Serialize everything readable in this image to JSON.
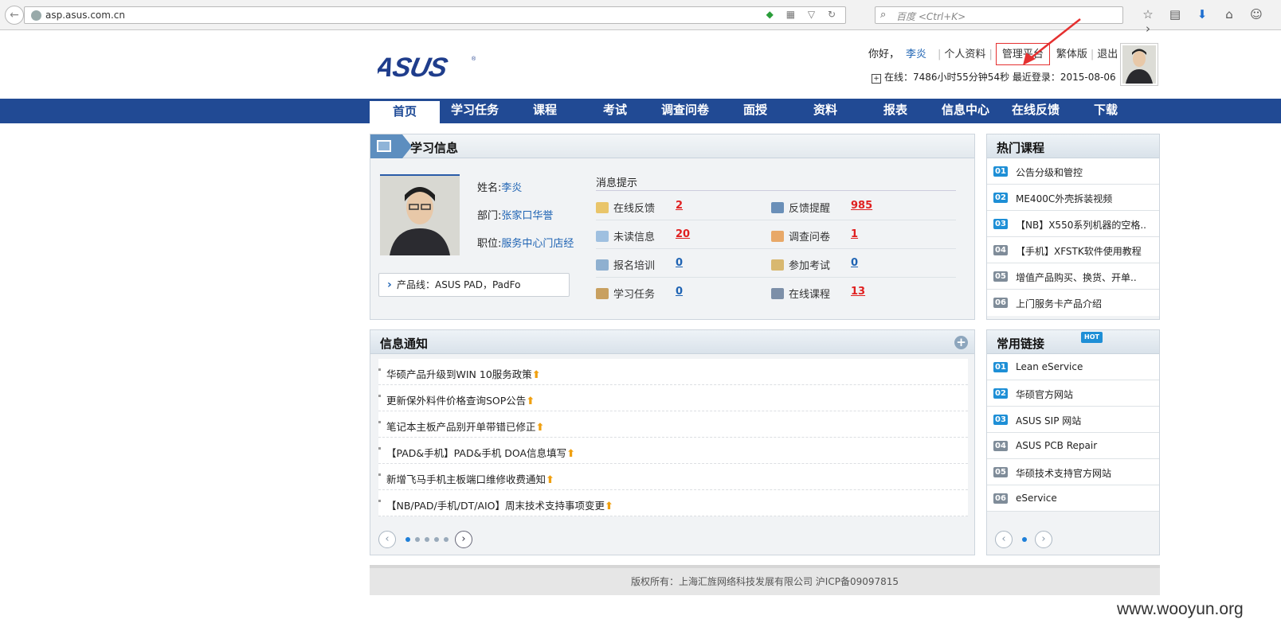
{
  "browser": {
    "url": "asp.asus.com.cn",
    "search_placeholder": "百度 <Ctrl+K>"
  },
  "header": {
    "greeting": "你好，",
    "user_name": "李炎",
    "profile_link": "个人资料",
    "admin_link": "管理平台",
    "traditional_link": "繁体版",
    "logout_link": "退出",
    "online_text": "在线：7486小时55分钟54秒  最近登录：2015-08-06"
  },
  "nav": {
    "items": [
      "首页",
      "学习任务",
      "课程",
      "考试",
      "调查问卷",
      "面授",
      "资料",
      "报表",
      "信息中心",
      "在线反馈",
      "下载"
    ]
  },
  "study": {
    "title": "学习信息",
    "name_label": "姓名:",
    "name": "李炎",
    "dept_label": "部门:",
    "dept": "张家口华誉",
    "position_label": "职位:",
    "position": "服务中心门店经",
    "product_line": "产品线：ASUS PAD，PadFo",
    "msg_title": "消息提示",
    "messages": [
      {
        "label": "在线反馈",
        "value": "2",
        "color": "red"
      },
      {
        "label": "反馈提醒",
        "value": "985",
        "color": "red"
      },
      {
        "label": "未读信息",
        "value": "20",
        "color": "red"
      },
      {
        "label": "调查问卷",
        "value": "1",
        "color": "red"
      },
      {
        "label": "报名培训",
        "value": "0",
        "color": "blue"
      },
      {
        "label": "参加考试",
        "value": "0",
        "color": "blue"
      },
      {
        "label": "学习任务",
        "value": "0",
        "color": "blue"
      },
      {
        "label": "在线课程",
        "value": "13",
        "color": "red"
      }
    ]
  },
  "hot_courses": {
    "title": "热门课程",
    "items": [
      {
        "idx": "01",
        "text": "公告分级和管控"
      },
      {
        "idx": "02",
        "text": "ME400C外壳拆装视频"
      },
      {
        "idx": "03",
        "text": "【NB】X550系列机器的空格.."
      },
      {
        "idx": "04",
        "text": "【手机】XFSTK软件使用教程"
      },
      {
        "idx": "05",
        "text": "增值产品购买、换货、开单.."
      },
      {
        "idx": "06",
        "text": "上门服务卡产品介绍"
      }
    ]
  },
  "notices": {
    "title": "信息通知",
    "items": [
      "华硕产品升级到WIN 10服务政策",
      "更新保外料件价格查询SOP公告",
      "笔记本主板产品别开单带错已修正",
      "【PAD&手机】PAD&手机 DOA信息填写",
      "新增飞马手机主板端口维修收费通知",
      "【NB/PAD/手机/DT/AIO】周末技术支持事项变更"
    ]
  },
  "links": {
    "title": "常用链接",
    "hot_badge": "HOT",
    "items": [
      {
        "idx": "01",
        "text": "Lean eService"
      },
      {
        "idx": "02",
        "text": "华硕官方网站"
      },
      {
        "idx": "03",
        "text": "ASUS SIP 网站"
      },
      {
        "idx": "04",
        "text": "ASUS PCB Repair"
      },
      {
        "idx": "05",
        "text": "华硕技术支持官方网站"
      },
      {
        "idx": "06",
        "text": "eService"
      }
    ]
  },
  "footer": {
    "text": "版权所有：上海汇旌网络科技发展有限公司 沪ICP备09097815"
  },
  "watermark": "www.wooyun.org",
  "colors": {
    "nav_bg": "#214a94",
    "accent_blue": "#1e63b3",
    "alert_red": "#e02020",
    "index_blue": "#1e8fd6",
    "index_gray": "#7f8c99"
  }
}
